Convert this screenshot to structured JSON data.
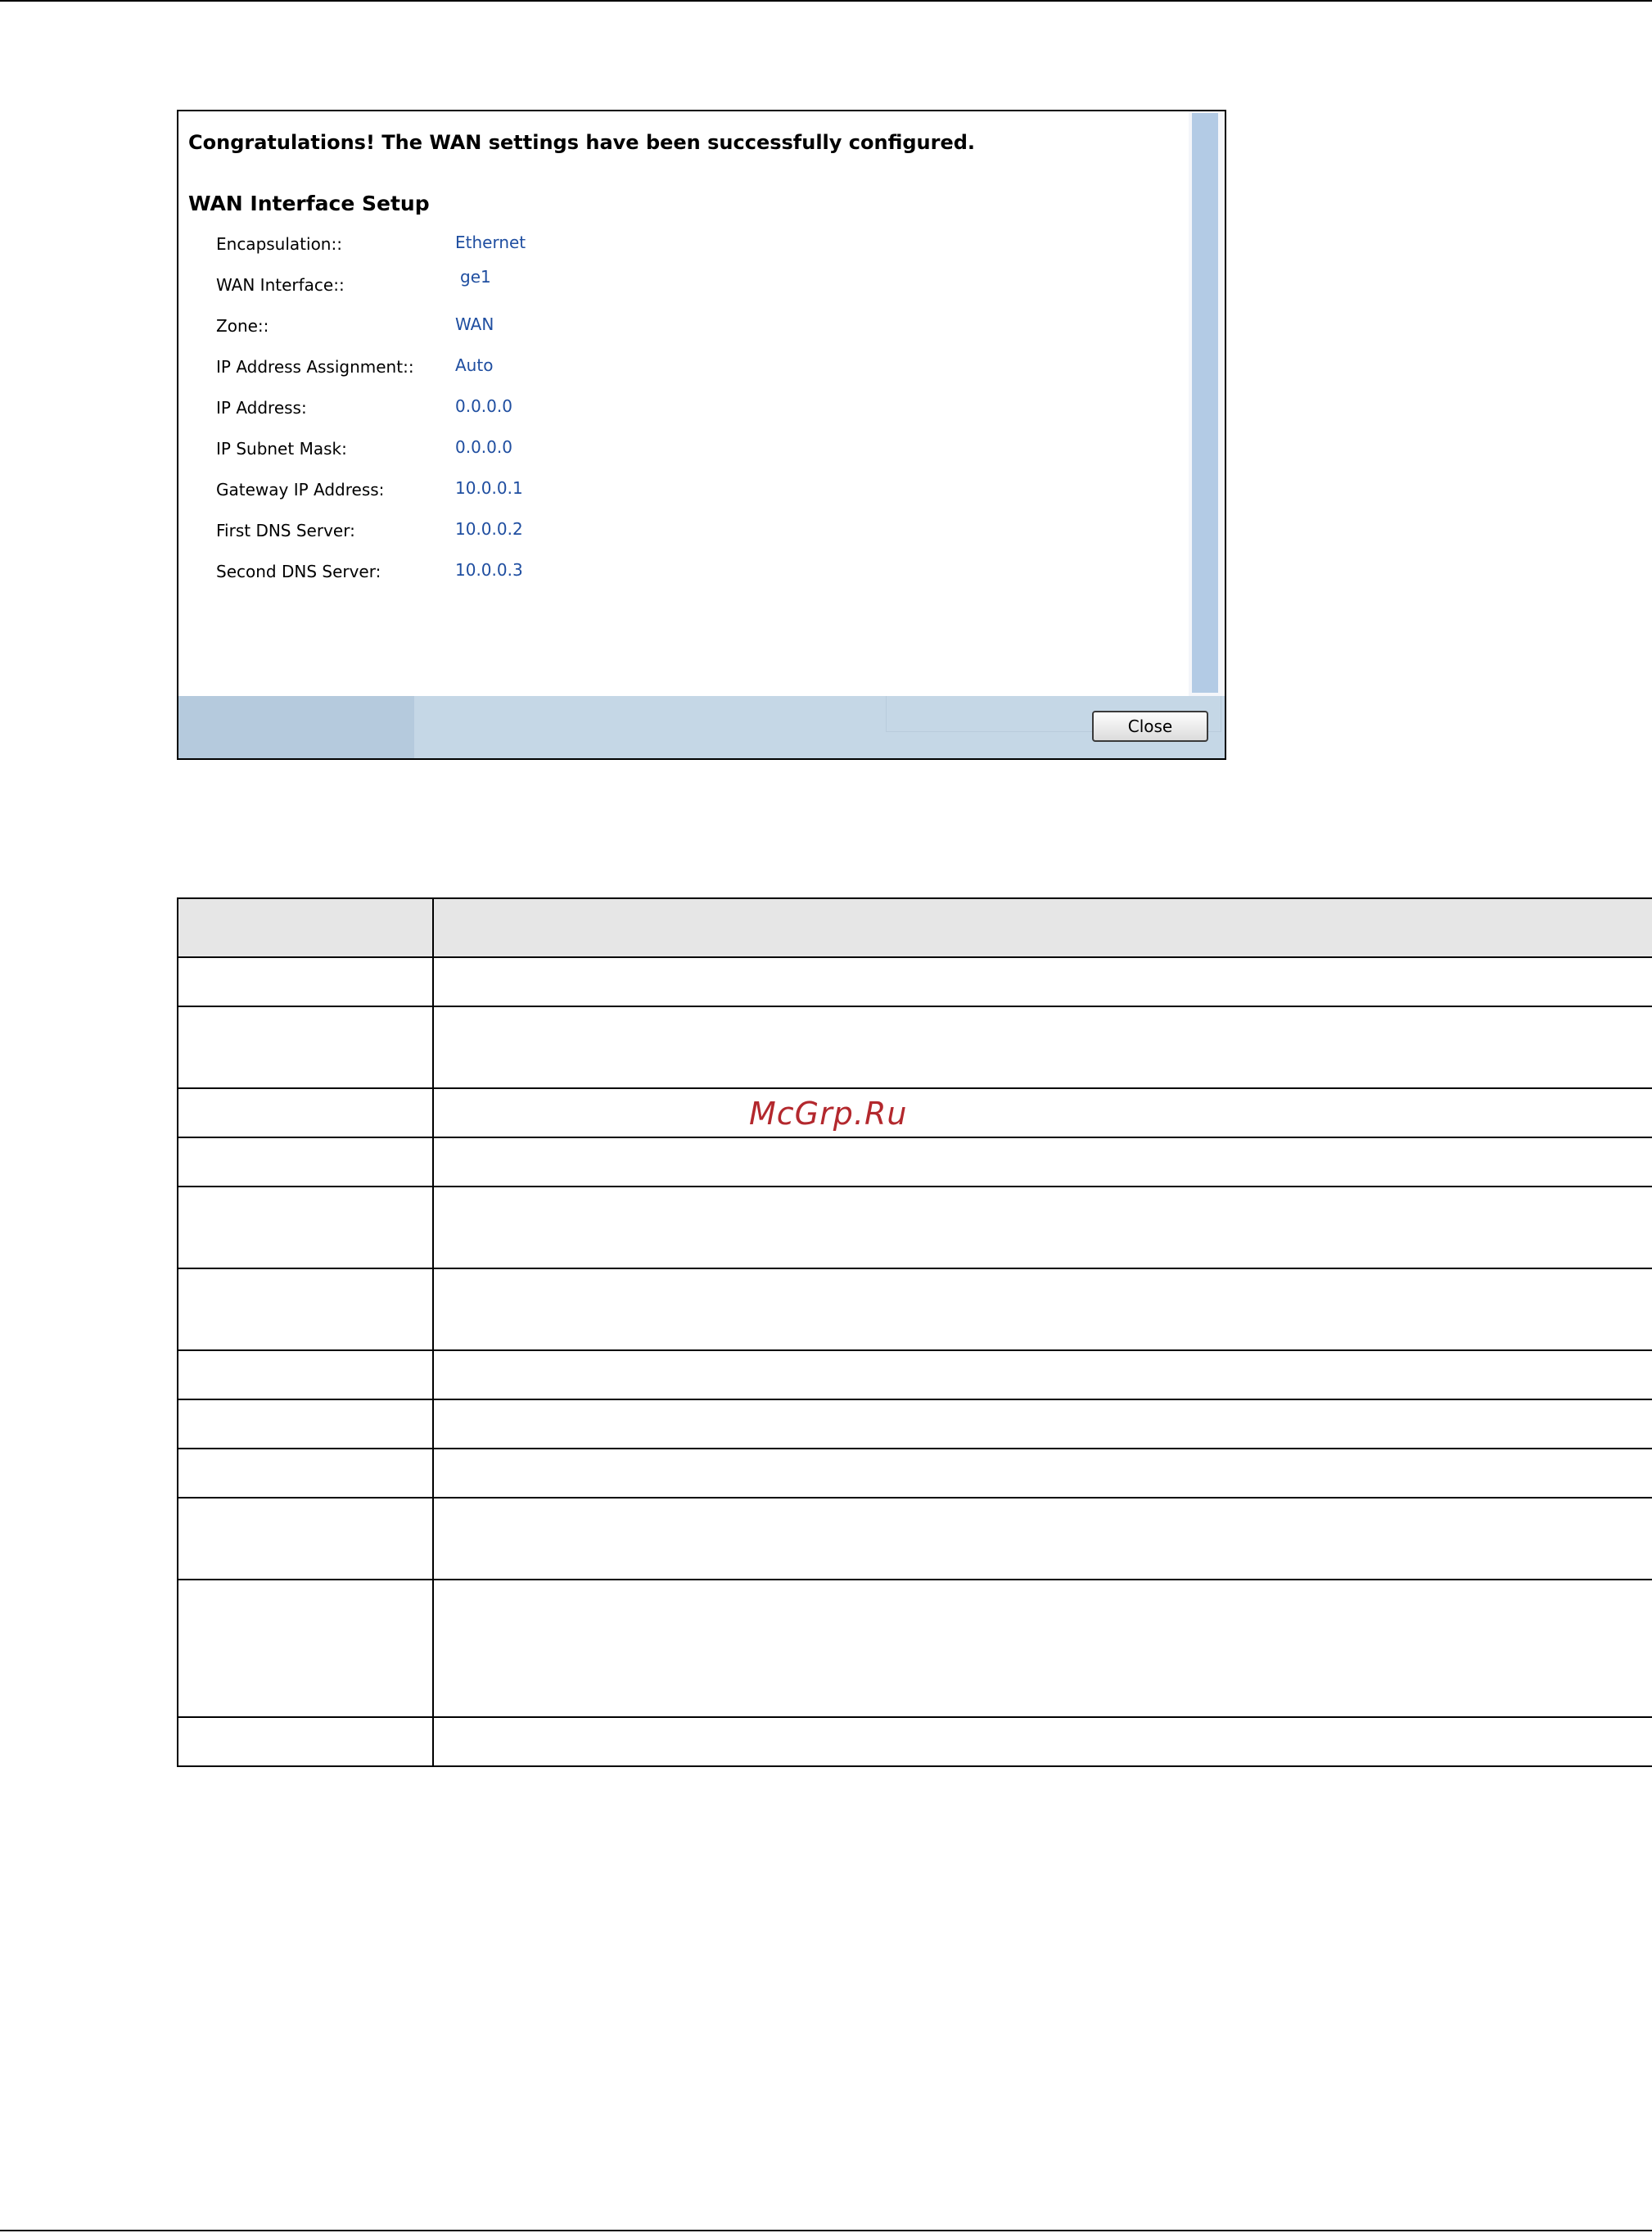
{
  "wizard": {
    "congrats_message": "Congratulations! The WAN settings have been successfully configured.",
    "section_title": "WAN Interface Setup",
    "rows": [
      {
        "label": "Encapsulation::",
        "value": "Ethernet"
      },
      {
        "label": "WAN Interface::",
        "value": "ge1"
      },
      {
        "label": "Zone::",
        "value": "WAN"
      },
      {
        "label": "IP Address Assignment::",
        "value": "Auto"
      },
      {
        "label": "IP Address:",
        "value": "0.0.0.0"
      },
      {
        "label": "IP Subnet Mask:",
        "value": "0.0.0.0"
      },
      {
        "label": "Gateway IP Address:",
        "value": "10.0.0.1"
      },
      {
        "label": "First DNS Server:",
        "value": "10.0.0.2"
      },
      {
        "label": "Second DNS Server:",
        "value": "10.0.0.3"
      }
    ],
    "close_label": "Close"
  },
  "watermark": "McGrp.Ru"
}
